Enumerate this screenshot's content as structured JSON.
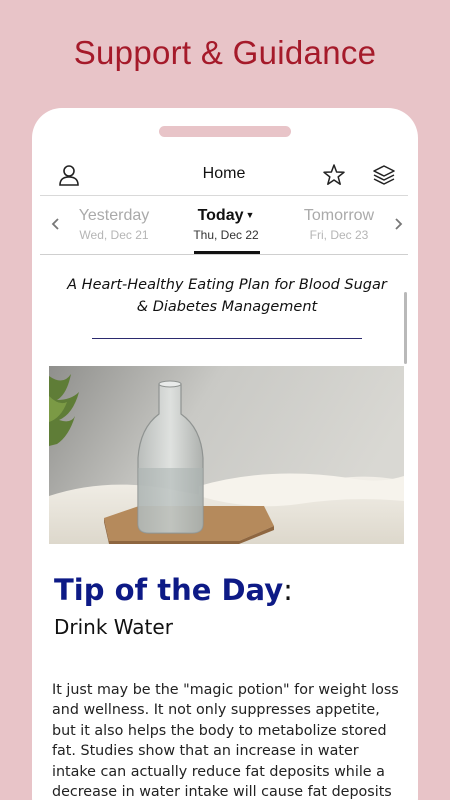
{
  "promo": {
    "title": "Support & Guidance"
  },
  "appbar": {
    "title": "Home",
    "icons": [
      "user-icon",
      "star-icon",
      "layers-icon"
    ]
  },
  "datebar": {
    "yesterday": {
      "name": "Yesterday",
      "date": "Wed, Dec 21"
    },
    "today": {
      "name": "Today",
      "date": "Thu, Dec 22"
    },
    "tomorrow": {
      "name": "Tomorrow",
      "date": "Fri, Dec 23"
    }
  },
  "article": {
    "headline": "A Heart-Healthy Eating Plan for Blood Sugar & Diabetes Management",
    "tip_label": "Tip of the Day",
    "tip_colon": ":",
    "tip_title": "Drink Water",
    "body": "It just may be the \"magic potion\" for weight loss and wellness.  It not only suppresses appetite, but it also helps the body to metabolize stored fat.  Studies show that an increase in water intake can actually reduce fat deposits while a decrease in water intake will cause fat deposits to increase."
  },
  "colors": {
    "background": "#e8c4c8",
    "promo_text": "#a51a2a",
    "tip_heading": "#0d1a86"
  }
}
